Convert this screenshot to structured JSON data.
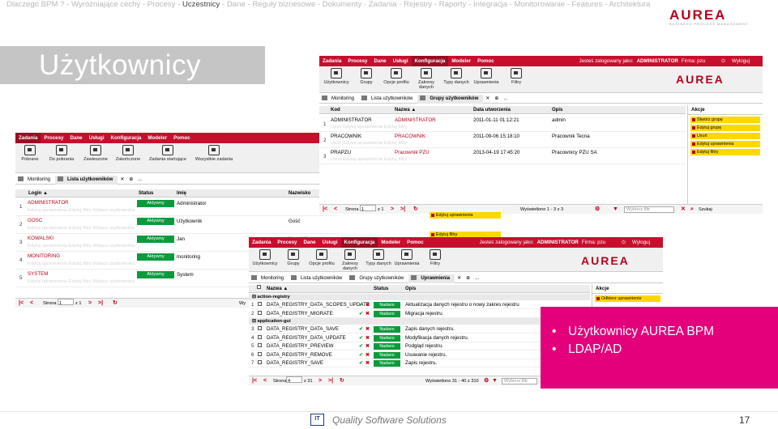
{
  "breadcrumb": {
    "items": [
      {
        "label": "Dlaczego BPM ?",
        "current": false
      },
      {
        "label": "Wyróżniające cechy",
        "current": false
      },
      {
        "label": "Procesy",
        "current": false
      },
      {
        "label": "Uczestnicy",
        "current": true
      },
      {
        "label": "Dane",
        "current": false
      },
      {
        "label": "Reguły biznesowe",
        "current": false
      },
      {
        "label": "Dokumenty",
        "current": false
      },
      {
        "label": "Zadania",
        "current": false
      },
      {
        "label": "Rejestry",
        "current": false
      },
      {
        "label": "Raporty",
        "current": false
      },
      {
        "label": "Integracja",
        "current": false
      },
      {
        "label": "Monitorowanie",
        "current": false
      },
      {
        "label": "Features",
        "current": false
      },
      {
        "label": "Architektura",
        "current": false
      }
    ],
    "separator": " - "
  },
  "logo": {
    "text": "AUREA",
    "subtitle": "BUSINESS PROCESS MANAGEMENT",
    "color": "#b8001e"
  },
  "slide": {
    "title": "Użytkownicy"
  },
  "colors": {
    "accent_red": "#c70f2d",
    "status_green": "#0c9b3c",
    "callout_pink": "#e4007a",
    "side_yellow": "#ffd800"
  },
  "win_users": {
    "menu": [
      "Zadania",
      "Procesy",
      "Dane",
      "Usługi",
      "Konfiguracja",
      "Modeler",
      "Pomoc"
    ],
    "toolbar": [
      "Pobrane",
      "Do pobrania",
      "Zawieszone",
      "Zakończone",
      "Zadania startujące",
      "Wszystkie zadania"
    ],
    "tabs": [
      "Monitoring",
      "Lista użytkowników"
    ],
    "tabs_more": "...",
    "columns": [
      "Login",
      "Status",
      "Imię",
      "Nazwisko"
    ],
    "sort_arrow": "▲",
    "row_links": "Edytuj uprawnienia   Edytuj filtry   Wyłącz użytkownika",
    "rows": [
      {
        "n": "1",
        "login": "ADMINISTRATOR",
        "status": "Aktywny",
        "name": "Administrator",
        "surname": ""
      },
      {
        "n": "2",
        "login": "GOSC",
        "status": "Aktywny",
        "name": "Użytkownik",
        "surname": "Gość"
      },
      {
        "n": "3",
        "login": "KOWALSKI",
        "status": "Aktywny",
        "name": "Jan",
        "surname": "Kowalski"
      },
      {
        "n": "4",
        "login": "MONITORING",
        "status": "Aktywny",
        "name": "monitoring",
        "surname": ""
      },
      {
        "n": "5",
        "login": "SYSTEM",
        "status": "Aktywny",
        "name": "System",
        "surname": ""
      }
    ],
    "pager": {
      "page_label": "Strona",
      "page": "1",
      "of": "z 1",
      "shown": "Wy"
    }
  },
  "win_groups": {
    "menu": [
      "Zadania",
      "Procesy",
      "Dane",
      "Usługi",
      "Konfiguracja",
      "Modeler",
      "Pomoc"
    ],
    "login_info": "Jesteś zalogowany jako: ",
    "login_user": "ADMINISTRATOR",
    "login_firm": " Firma: pzu",
    "logout": "Wyloguj",
    "toolbar": [
      "Użytkownicy",
      "Grupy",
      "Opcje profilu",
      "Zakresy danych",
      "Typy danych",
      "Uprawnienia",
      "Filtry"
    ],
    "tabs": [
      "Monitoring",
      "Lista użytkowników",
      "Grupy użytkowników"
    ],
    "tabs_more": "...",
    "columns": [
      "Kod",
      "Nazwa",
      "Data utworzenia",
      "Opis"
    ],
    "sort_arrow": "▲",
    "row_links": "Usuń   Edytuj uprawnienia   Edytuj filtry",
    "rows": [
      {
        "n": "1",
        "code": "ADMINISTRATOR",
        "name": "ADMINISTRATOR",
        "date": "2011-01-11 01:12:21",
        "desc": "admin"
      },
      {
        "n": "2",
        "code": "PRACOWNIK",
        "name": "PRACOWNIK",
        "date": "2011-09-06 15:18:10",
        "desc": "Pracownik Tecna"
      },
      {
        "n": "3",
        "code": "PRAPZU",
        "name": "Pracownik PZU",
        "date": "2013-04-19 17:45:20",
        "desc": "Pracownicy PZU SA"
      }
    ],
    "side_title": "Akcje",
    "side_items": [
      "Stwórz grupę",
      "Edytuj grupę",
      "Usuń",
      "Edytuj uprawnienia",
      "Edytuj filtry"
    ],
    "peek_items": [
      "Edytuj uprawnienia",
      "Edytuj filtry"
    ],
    "pager": {
      "page_label": "Strona",
      "page": "1",
      "of": "z 1",
      "shown": "Wyświetlono 1 - 3 z 3",
      "filter_placeholder": "Wybierz filtr",
      "search": "Szukaj"
    }
  },
  "win_perms": {
    "menu": [
      "Zadania",
      "Procesy",
      "Dane",
      "Usługi",
      "Konfiguracja",
      "Modeler",
      "Pomoc"
    ],
    "login_info": "Jesteś zalogowany jako: ",
    "login_user": "ADMINISTRATOR",
    "login_firm": " Firma: pzu",
    "logout": "Wyloguj",
    "toolbar": [
      "Użytkownicy",
      "Grupy",
      "Opcje profilu",
      "Zakresy danych",
      "Typy danych",
      "Uprawnienia",
      "Filtry"
    ],
    "tabs": [
      "Monitoring",
      "Lista użytkowników",
      "Grupy użytkowników",
      "Uprawnienia"
    ],
    "tabs_more": "...",
    "columns": [
      "Nazwa",
      "Status",
      "Opis"
    ],
    "sort_arrow": "▲",
    "groups": [
      {
        "label": "action-registry",
        "rows": [
          {
            "n": "1",
            "name": "DATA_REGISTRY_DATA_SCOPES_UPDATE",
            "status": "Nadano",
            "desc": "Aktualizacja danych rejestru o nowy zakres rejestru"
          },
          {
            "n": "2",
            "name": "DATA_REGISTRY_MIGRATE",
            "status": "Nadano",
            "desc": "Migracja rejestru"
          }
        ]
      },
      {
        "label": "application-gui",
        "rows": [
          {
            "n": "3",
            "name": "DATA_REGISTRY_DATA_SAVE",
            "status": "Nadano",
            "desc": "Zapis danych rejestru."
          },
          {
            "n": "4",
            "name": "DATA_REGISTRY_DATA_UPDATE",
            "status": "Nadano",
            "desc": "Modyfikacja danych rejestru."
          },
          {
            "n": "5",
            "name": "DATA_REGISTRY_PREVIEW",
            "status": "Nadano",
            "desc": "Podgląd rejestru."
          },
          {
            "n": "6",
            "name": "DATA_REGISTRY_REMOVE",
            "status": "Nadano",
            "desc": "Usuwanie rejestru."
          },
          {
            "n": "7",
            "name": "DATA_REGISTRY_SAVE",
            "status": "Nadano",
            "desc": "Zapis rejestru."
          }
        ]
      }
    ],
    "side_title": "Akcje",
    "side_items": [
      "Odbierz uprawnienie"
    ],
    "pager": {
      "page_label": "Strona",
      "page": "4",
      "of": "z 31",
      "shown": "Wyświetlono 31 - 40 z 310",
      "filter_placeholder": "Wybierz filtr"
    }
  },
  "callout": {
    "items": [
      "Użytkownicy AUREA BPM",
      "LDAP/AD"
    ]
  },
  "footer": {
    "logo_text": "IT",
    "tagline": "Quality Software Solutions",
    "page_number": "17"
  }
}
